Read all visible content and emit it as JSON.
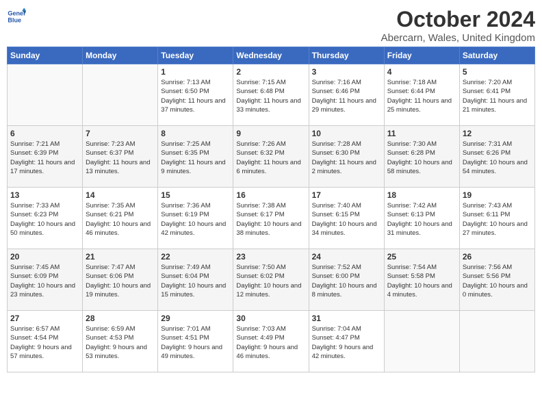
{
  "header": {
    "logo_line1": "General",
    "logo_line2": "Blue",
    "month": "October 2024",
    "location": "Abercarn, Wales, United Kingdom"
  },
  "days_of_week": [
    "Sunday",
    "Monday",
    "Tuesday",
    "Wednesday",
    "Thursday",
    "Friday",
    "Saturday"
  ],
  "weeks": [
    [
      {
        "day": "",
        "info": ""
      },
      {
        "day": "",
        "info": ""
      },
      {
        "day": "1",
        "info": "Sunrise: 7:13 AM\nSunset: 6:50 PM\nDaylight: 11 hours and 37 minutes."
      },
      {
        "day": "2",
        "info": "Sunrise: 7:15 AM\nSunset: 6:48 PM\nDaylight: 11 hours and 33 minutes."
      },
      {
        "day": "3",
        "info": "Sunrise: 7:16 AM\nSunset: 6:46 PM\nDaylight: 11 hours and 29 minutes."
      },
      {
        "day": "4",
        "info": "Sunrise: 7:18 AM\nSunset: 6:44 PM\nDaylight: 11 hours and 25 minutes."
      },
      {
        "day": "5",
        "info": "Sunrise: 7:20 AM\nSunset: 6:41 PM\nDaylight: 11 hours and 21 minutes."
      }
    ],
    [
      {
        "day": "6",
        "info": "Sunrise: 7:21 AM\nSunset: 6:39 PM\nDaylight: 11 hours and 17 minutes."
      },
      {
        "day": "7",
        "info": "Sunrise: 7:23 AM\nSunset: 6:37 PM\nDaylight: 11 hours and 13 minutes."
      },
      {
        "day": "8",
        "info": "Sunrise: 7:25 AM\nSunset: 6:35 PM\nDaylight: 11 hours and 9 minutes."
      },
      {
        "day": "9",
        "info": "Sunrise: 7:26 AM\nSunset: 6:32 PM\nDaylight: 11 hours and 6 minutes."
      },
      {
        "day": "10",
        "info": "Sunrise: 7:28 AM\nSunset: 6:30 PM\nDaylight: 11 hours and 2 minutes."
      },
      {
        "day": "11",
        "info": "Sunrise: 7:30 AM\nSunset: 6:28 PM\nDaylight: 10 hours and 58 minutes."
      },
      {
        "day": "12",
        "info": "Sunrise: 7:31 AM\nSunset: 6:26 PM\nDaylight: 10 hours and 54 minutes."
      }
    ],
    [
      {
        "day": "13",
        "info": "Sunrise: 7:33 AM\nSunset: 6:23 PM\nDaylight: 10 hours and 50 minutes."
      },
      {
        "day": "14",
        "info": "Sunrise: 7:35 AM\nSunset: 6:21 PM\nDaylight: 10 hours and 46 minutes."
      },
      {
        "day": "15",
        "info": "Sunrise: 7:36 AM\nSunset: 6:19 PM\nDaylight: 10 hours and 42 minutes."
      },
      {
        "day": "16",
        "info": "Sunrise: 7:38 AM\nSunset: 6:17 PM\nDaylight: 10 hours and 38 minutes."
      },
      {
        "day": "17",
        "info": "Sunrise: 7:40 AM\nSunset: 6:15 PM\nDaylight: 10 hours and 34 minutes."
      },
      {
        "day": "18",
        "info": "Sunrise: 7:42 AM\nSunset: 6:13 PM\nDaylight: 10 hours and 31 minutes."
      },
      {
        "day": "19",
        "info": "Sunrise: 7:43 AM\nSunset: 6:11 PM\nDaylight: 10 hours and 27 minutes."
      }
    ],
    [
      {
        "day": "20",
        "info": "Sunrise: 7:45 AM\nSunset: 6:09 PM\nDaylight: 10 hours and 23 minutes."
      },
      {
        "day": "21",
        "info": "Sunrise: 7:47 AM\nSunset: 6:06 PM\nDaylight: 10 hours and 19 minutes."
      },
      {
        "day": "22",
        "info": "Sunrise: 7:49 AM\nSunset: 6:04 PM\nDaylight: 10 hours and 15 minutes."
      },
      {
        "day": "23",
        "info": "Sunrise: 7:50 AM\nSunset: 6:02 PM\nDaylight: 10 hours and 12 minutes."
      },
      {
        "day": "24",
        "info": "Sunrise: 7:52 AM\nSunset: 6:00 PM\nDaylight: 10 hours and 8 minutes."
      },
      {
        "day": "25",
        "info": "Sunrise: 7:54 AM\nSunset: 5:58 PM\nDaylight: 10 hours and 4 minutes."
      },
      {
        "day": "26",
        "info": "Sunrise: 7:56 AM\nSunset: 5:56 PM\nDaylight: 10 hours and 0 minutes."
      }
    ],
    [
      {
        "day": "27",
        "info": "Sunrise: 6:57 AM\nSunset: 4:54 PM\nDaylight: 9 hours and 57 minutes."
      },
      {
        "day": "28",
        "info": "Sunrise: 6:59 AM\nSunset: 4:53 PM\nDaylight: 9 hours and 53 minutes."
      },
      {
        "day": "29",
        "info": "Sunrise: 7:01 AM\nSunset: 4:51 PM\nDaylight: 9 hours and 49 minutes."
      },
      {
        "day": "30",
        "info": "Sunrise: 7:03 AM\nSunset: 4:49 PM\nDaylight: 9 hours and 46 minutes."
      },
      {
        "day": "31",
        "info": "Sunrise: 7:04 AM\nSunset: 4:47 PM\nDaylight: 9 hours and 42 minutes."
      },
      {
        "day": "",
        "info": ""
      },
      {
        "day": "",
        "info": ""
      }
    ]
  ]
}
